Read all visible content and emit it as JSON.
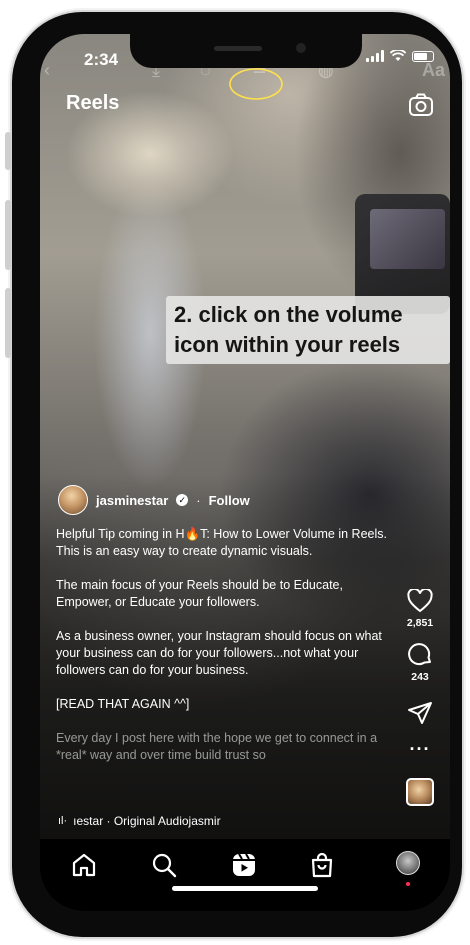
{
  "status": {
    "time": "2:34"
  },
  "header": {
    "title": "Reels"
  },
  "overlay": {
    "caption": "2. click on the volume icon within your reels"
  },
  "post": {
    "author": "jasminestar",
    "separator": "·",
    "follow_label": "Follow",
    "caption_paragraphs": [
      "Helpful Tip coming in H🔥T: How to Lower Volume in Reels. This is an easy way to create dynamic visuals.",
      "The main focus of your Reels should be to Educate, Empower, or Educate your followers.",
      "As a business owner, your Instagram should focus on what your business can do for your followers...not what your followers can do for your business.",
      "[READ THAT AGAIN ^^]",
      "Every day I post here with the hope we get to connect in a *real* way and over time build trust so"
    ],
    "audio": "ıestar · Original Audiojasmir"
  },
  "actions": {
    "likes": "2,851",
    "comments": "243",
    "more": "···"
  },
  "nav": {
    "items": [
      "home-icon",
      "search-icon",
      "reels-icon",
      "shop-icon",
      "profile-avatar"
    ]
  },
  "colors": {
    "accent_dot": "#ff2d55",
    "nav_bg": "#000000"
  }
}
